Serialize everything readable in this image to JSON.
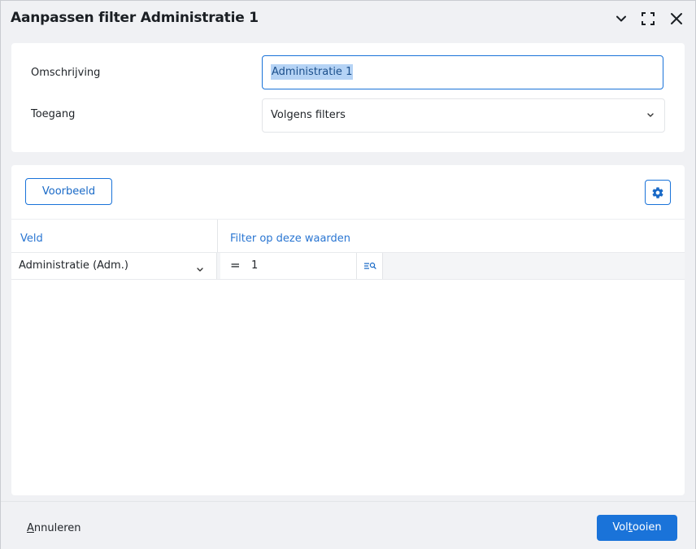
{
  "dialog": {
    "title": "Aanpassen filter Administratie 1"
  },
  "form": {
    "description_label": "Omschrijving",
    "description_value": "Administratie 1",
    "access_label": "Toegang",
    "access_selected": "Volgens filters"
  },
  "toolbar": {
    "preview_label": "Voorbeeld"
  },
  "grid": {
    "columns": [
      "Veld",
      "Filter op deze waarden"
    ],
    "rows": [
      {
        "field": "Administratie (Adm.)",
        "operator": "=",
        "value": "1"
      }
    ]
  },
  "footer": {
    "cancel_label_prefix": "",
    "cancel_label_accel": "A",
    "cancel_label_rest": "nnuleren",
    "finish_label_prefix": "Vol",
    "finish_label_accel": "t",
    "finish_label_rest": "ooien"
  },
  "icons": {
    "collapse": "chevron-down-icon",
    "maximize": "maximize-icon",
    "close": "close-icon",
    "settings": "gear-icon",
    "lookup": "filter-lookup-icon"
  },
  "colors": {
    "accent": "#1a73d9",
    "header_text": "#2a76d2",
    "background": "#f0f1f4",
    "card": "#ffffff"
  }
}
